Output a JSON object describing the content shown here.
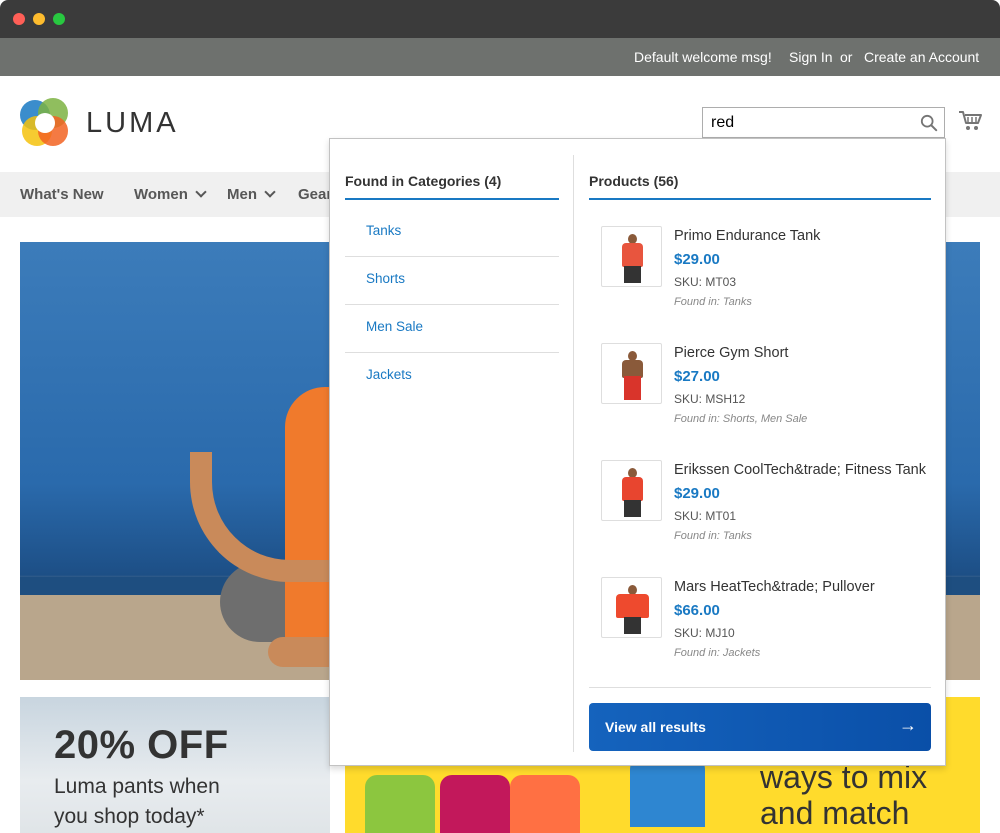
{
  "header": {
    "welcome": "Default welcome msg!",
    "sign_in": "Sign In",
    "or": "or",
    "create_account": "Create an Account"
  },
  "logo": {
    "text": "LUMA"
  },
  "search": {
    "value": "red",
    "icon": "search-icon"
  },
  "cart": {
    "icon": "cart-icon"
  },
  "nav": {
    "items": [
      {
        "label": "What's New",
        "has_dropdown": false
      },
      {
        "label": "Women",
        "has_dropdown": true
      },
      {
        "label": "Men",
        "has_dropdown": true
      },
      {
        "label": "Gear",
        "has_dropdown": false
      }
    ]
  },
  "autocomplete": {
    "categories_heading": "Found in Categories (4)",
    "categories": [
      "Tanks",
      "Shorts",
      "Men Sale",
      "Jackets"
    ],
    "products_heading": "Products (56)",
    "products": [
      {
        "name": "Primo Endurance Tank",
        "price": "$29.00",
        "sku": "SKU: MT03",
        "found_in": "Found in: Tanks",
        "color": "#e8553e"
      },
      {
        "name": "Pierce Gym Short",
        "price": "$27.00",
        "sku": "SKU: MSH12",
        "found_in": "Found in: Shorts, Men Sale",
        "color": "#d9342b"
      },
      {
        "name": "Erikssen CoolTech&trade; Fitness Tank",
        "price": "$29.00",
        "sku": "SKU: MT01",
        "found_in": "Found in: Tanks",
        "color": "#e8452f"
      },
      {
        "name": "Mars HeatTech&trade; Pullover",
        "price": "$66.00",
        "sku": "SKU: MJ10",
        "found_in": "Found in: Jackets",
        "color": "#ee4a2e"
      }
    ],
    "view_all": "View all results",
    "view_all_arrow": "→"
  },
  "promos": {
    "left": {
      "headline": "20% OFF",
      "line1": "Luma pants when",
      "line2": "you shop today*"
    },
    "right": {
      "line1": "ways to mix",
      "line2": "and match"
    }
  },
  "colors": {
    "accent": "#1979c3",
    "topbar": "#6e716e",
    "promo_yellow": "#ffdb2c"
  }
}
